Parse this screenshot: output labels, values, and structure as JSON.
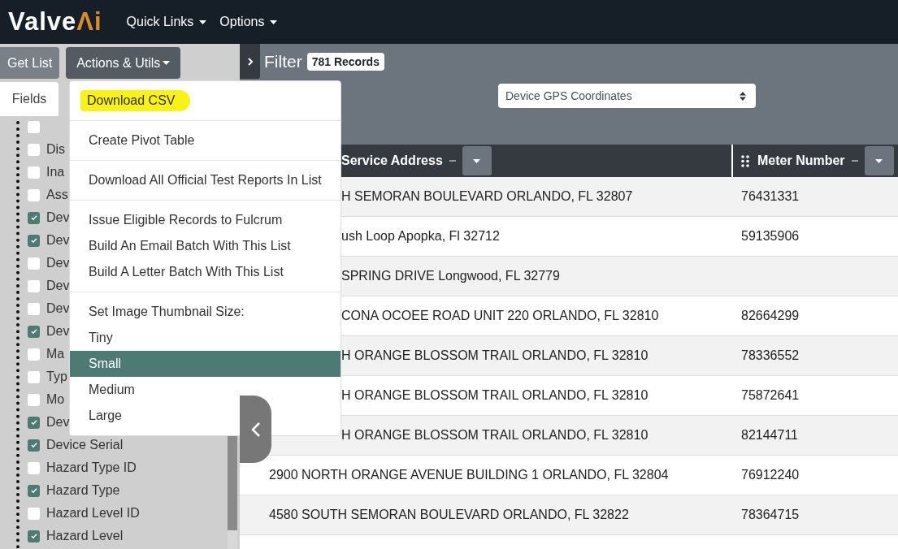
{
  "navbar": {
    "logo": {
      "text": "Valve",
      "accent": "Λi"
    },
    "menus": [
      {
        "label": "Quick Links"
      },
      {
        "label": "Options"
      }
    ]
  },
  "toolbar": {
    "buttons": [
      {
        "label": "Get List",
        "kind": "plain"
      },
      {
        "label": "Actions & Utils",
        "kind": "dropdown",
        "expanded": true
      }
    ]
  },
  "tabs": [
    {
      "label": "Fields",
      "selected": true
    }
  ],
  "partial_field": {
    "checked": false
  },
  "fields": [
    {
      "label": "Dis",
      "checked": false
    },
    {
      "label": "Ina",
      "checked": false
    },
    {
      "label": "Ass",
      "checked": false
    },
    {
      "label": "Dev",
      "checked": true
    },
    {
      "label": "Dev",
      "checked": true
    },
    {
      "label": "Dev",
      "checked": false
    },
    {
      "label": "Dev",
      "checked": false
    },
    {
      "label": "Dev",
      "checked": false
    },
    {
      "label": "Dev",
      "checked": true
    },
    {
      "label": "Ma",
      "checked": false
    },
    {
      "label": "Typ",
      "checked": false
    },
    {
      "label": "Mo",
      "checked": false
    },
    {
      "label": "Dev",
      "checked": true
    },
    {
      "label": "Device Serial",
      "checked": true
    },
    {
      "label": "Hazard Type ID",
      "checked": false
    },
    {
      "label": "Hazard Type",
      "checked": true
    },
    {
      "label": "Hazard Level ID",
      "checked": false
    },
    {
      "label": "Hazard Level",
      "checked": true
    }
  ],
  "actions_menu": {
    "sections": [
      [
        {
          "label": "Download CSV",
          "kind": "action",
          "highlighted": true
        }
      ],
      [
        {
          "label": "Create Pivot Table",
          "kind": "action",
          "highlighted": false
        }
      ],
      [
        {
          "label": "Download All Official Test Reports In List",
          "kind": "action",
          "highlighted": false
        }
      ],
      [
        {
          "label": "Issue Eligible Records to Fulcrum",
          "kind": "action",
          "highlighted": false
        },
        {
          "label": "Build An Email Batch With This List",
          "kind": "action",
          "highlighted": false
        },
        {
          "label": "Build A Letter Batch With This List",
          "kind": "action",
          "highlighted": false
        }
      ],
      [
        {
          "label": "Set Image Thumbnail Size:",
          "kind": "header"
        },
        {
          "label": "Tiny",
          "kind": "option",
          "selected": false
        },
        {
          "label": "Small",
          "kind": "option",
          "selected": true
        },
        {
          "label": "Medium",
          "kind": "option",
          "selected": false
        },
        {
          "label": "Large",
          "kind": "option",
          "selected": false
        }
      ]
    ]
  },
  "filter": {
    "title": "Filter",
    "record_count": "781 Records",
    "select": {
      "value": "Device GPS Coordinates"
    }
  },
  "table": {
    "columns": [
      {
        "label": "Service Address",
        "kind": "text"
      },
      {
        "label": "Meter Number",
        "kind": "grip"
      }
    ],
    "rows": [
      {
        "partly_hidden": true,
        "cells": [
          "H SEMORAN BOULEVARD ORLANDO, FL 32807",
          "76431331"
        ]
      },
      {
        "partly_hidden": true,
        "cells": [
          "ush Loop Apopka, Fl 32712",
          "59135906"
        ]
      },
      {
        "partly_hidden": true,
        "cells": [
          "SPRING DRIVE Longwood, FL 32779",
          ""
        ]
      },
      {
        "partly_hidden": true,
        "cells": [
          "CONA OCOEE ROAD UNIT 220 ORLANDO, FL 32810",
          "82664299"
        ]
      },
      {
        "partly_hidden": true,
        "cells": [
          "H ORANGE BLOSSOM TRAIL ORLANDO, FL 32810",
          "78336552"
        ]
      },
      {
        "partly_hidden": true,
        "cells": [
          "H ORANGE BLOSSOM TRAIL ORLANDO, FL 32810",
          "75872641"
        ]
      },
      {
        "partly_hidden": true,
        "cells": [
          "H ORANGE BLOSSOM TRAIL ORLANDO, FL 32810",
          "82144711"
        ]
      },
      {
        "partly_hidden": false,
        "cells": [
          "2900 NORTH ORANGE AVENUE BUILDING 1 ORLANDO, FL 32804",
          "76912240"
        ]
      },
      {
        "partly_hidden": false,
        "cells": [
          "4580 SOUTH SEMORAN BOULEVARD ORLANDO, FL 32822",
          "78364715"
        ]
      }
    ]
  }
}
